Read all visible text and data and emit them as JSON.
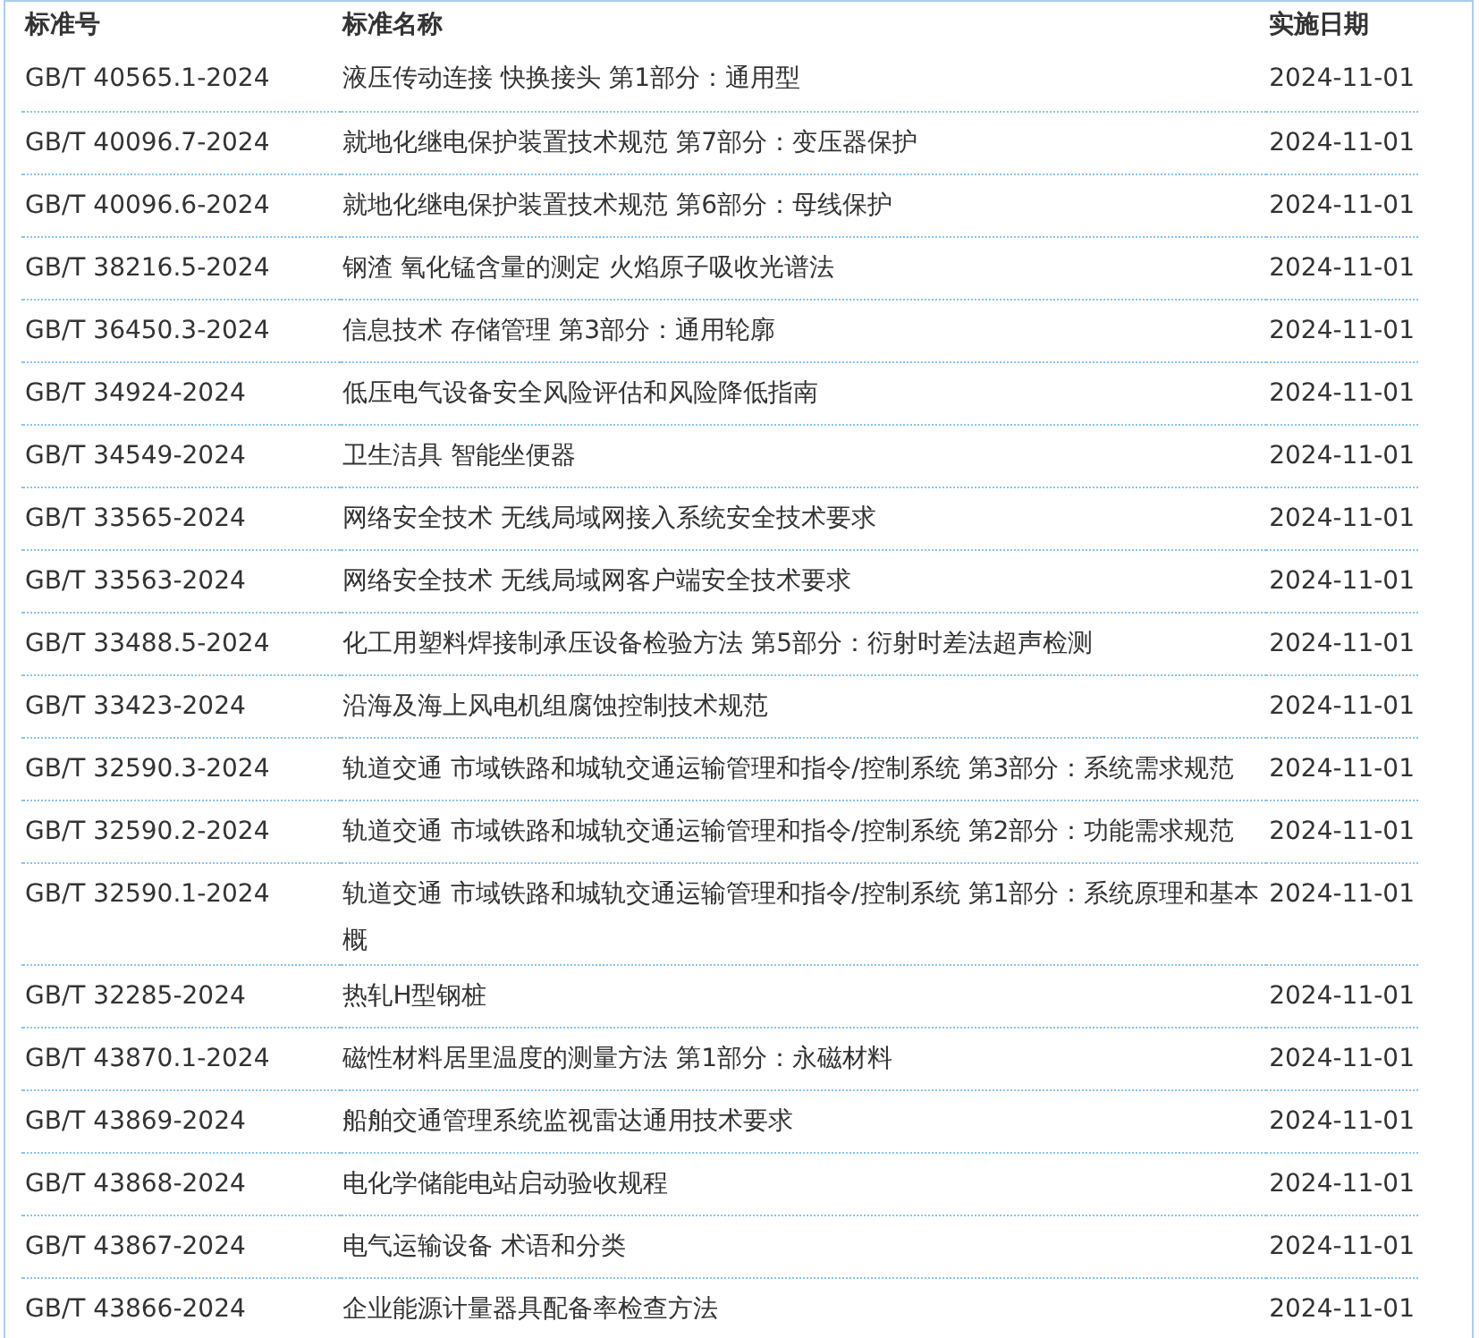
{
  "table": {
    "columns": [
      "标准号",
      "标准名称",
      "实施日期"
    ],
    "rows": [
      [
        "GB/T 40565.1-2024",
        "液压传动连接 快换接头 第1部分：通用型",
        "2024-11-01"
      ],
      [
        "GB/T 40096.7-2024",
        "就地化继电保护装置技术规范 第7部分：变压器保护",
        "2024-11-01"
      ],
      [
        "GB/T 40096.6-2024",
        "就地化继电保护装置技术规范 第6部分：母线保护",
        "2024-11-01"
      ],
      [
        "GB/T 38216.5-2024",
        "钢渣 氧化锰含量的测定 火焰原子吸收光谱法",
        "2024-11-01"
      ],
      [
        "GB/T 36450.3-2024",
        "信息技术 存储管理 第3部分：通用轮廓",
        "2024-11-01"
      ],
      [
        "GB/T 34924-2024",
        "低压电气设备安全风险评估和风险降低指南",
        "2024-11-01"
      ],
      [
        "GB/T 34549-2024",
        "卫生洁具 智能坐便器",
        "2024-11-01"
      ],
      [
        "GB/T 33565-2024",
        "网络安全技术 无线局域网接入系统安全技术要求",
        "2024-11-01"
      ],
      [
        "GB/T 33563-2024",
        "网络安全技术 无线局域网客户端安全技术要求",
        "2024-11-01"
      ],
      [
        "GB/T 33488.5-2024",
        "化工用塑料焊接制承压设备检验方法 第5部分：衍射时差法超声检测",
        "2024-11-01"
      ],
      [
        "GB/T 33423-2024",
        "沿海及海上风电机组腐蚀控制技术规范",
        "2024-11-01"
      ],
      [
        "GB/T 32590.3-2024",
        "轨道交通 市域铁路和城轨交通运输管理和指令/控制系统 第3部分：系统需求规范",
        "2024-11-01"
      ],
      [
        "GB/T 32590.2-2024",
        "轨道交通 市域铁路和城轨交通运输管理和指令/控制系统 第2部分：功能需求规范",
        "2024-11-01"
      ],
      [
        "GB/T 32590.1-2024",
        "轨道交通 市域铁路和城轨交通运输管理和指令/控制系统 第1部分：系统原理和基本概",
        "2024-11-01"
      ],
      [
        "GB/T 32285-2024",
        "热轧H型钢桩",
        "2024-11-01"
      ],
      [
        "GB/T 43870.1-2024",
        "磁性材料居里温度的测量方法 第1部分：永磁材料",
        "2024-11-01"
      ],
      [
        "GB/T 43869-2024",
        "船舶交通管理系统监视雷达通用技术要求",
        "2024-11-01"
      ],
      [
        "GB/T 43868-2024",
        "电化学储能电站启动验收规程",
        "2024-11-01"
      ],
      [
        "GB/T 43867-2024",
        "电气运输设备 术语和分类",
        "2024-11-01"
      ],
      [
        "GB/T 43866-2024",
        "企业能源计量器具配备率检查方法",
        "2024-11-01"
      ]
    ]
  }
}
